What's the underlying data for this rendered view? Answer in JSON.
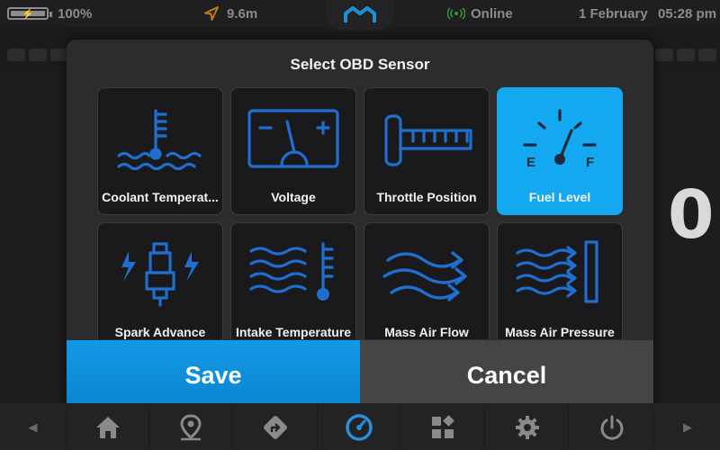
{
  "status": {
    "battery_percent": "100%",
    "battery_level": 1.0,
    "distance": "9.6m",
    "connection": "Online",
    "date": "1 February",
    "time": "05:28 pm"
  },
  "background": {
    "readout_digit": "0"
  },
  "modal": {
    "title": "Select OBD Sensor",
    "sensors": [
      {
        "label": "Coolant Temperat...",
        "icon": "coolant-temperature-icon",
        "selected": false
      },
      {
        "label": "Voltage",
        "icon": "battery-voltage-icon",
        "selected": false
      },
      {
        "label": "Throttle Position",
        "icon": "throttle-position-icon",
        "selected": false
      },
      {
        "label": "Fuel Level",
        "icon": "fuel-gauge-icon",
        "selected": true
      },
      {
        "label": "Spark Advance",
        "icon": "spark-plug-icon",
        "selected": false
      },
      {
        "label": "Intake Temperature",
        "icon": "intake-temperature-icon",
        "selected": false
      },
      {
        "label": "Mass Air Flow",
        "icon": "air-flow-icon",
        "selected": false
      },
      {
        "label": "Mass Air Pressure",
        "icon": "air-pressure-icon",
        "selected": false
      }
    ],
    "save_label": "Save",
    "cancel_label": "Cancel"
  },
  "nav": {
    "items": [
      "prev-arrow-icon",
      "home-icon",
      "location-pin-icon",
      "directions-icon",
      "gauge-icon",
      "widgets-icon",
      "gear-icon",
      "power-icon",
      "next-arrow-icon"
    ],
    "active": "gauge-icon"
  },
  "colors": {
    "accent": "#14a8f0",
    "icon_blue": "#1f6fd0",
    "online_green": "#2f9a3a"
  }
}
